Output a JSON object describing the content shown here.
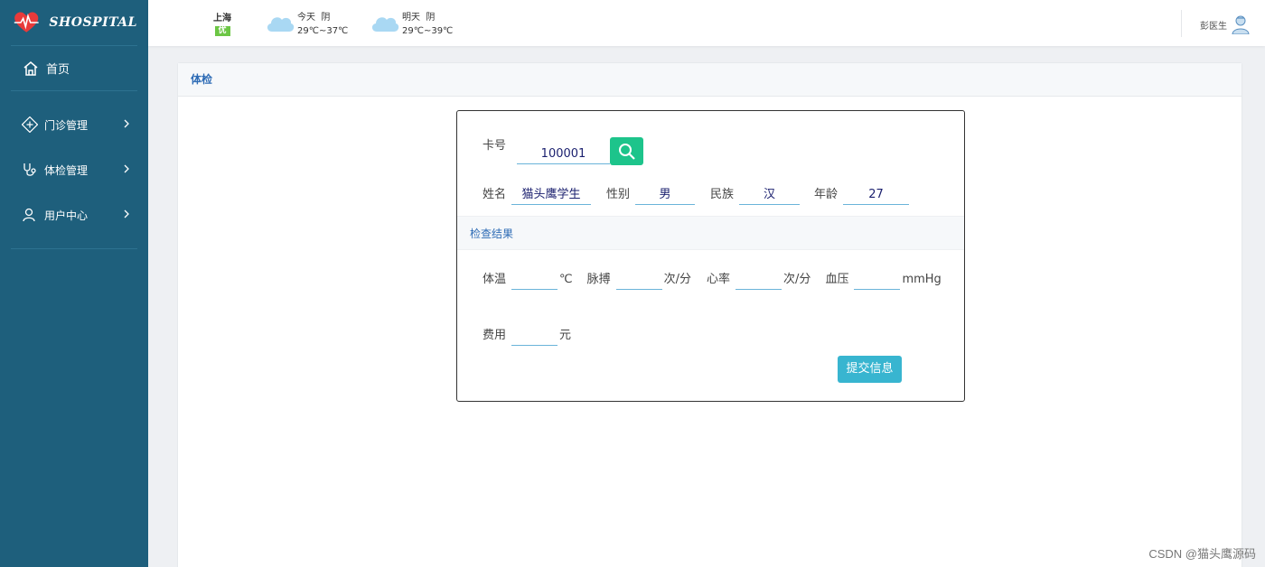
{
  "app": {
    "logo_text": "SHOSPITAL"
  },
  "sidebar": {
    "home_label": "首页",
    "items": [
      {
        "label": "门诊管理"
      },
      {
        "label": "体检管理"
      },
      {
        "label": "用户中心"
      }
    ]
  },
  "topbar": {
    "city": "上海",
    "aqi": "优",
    "today": {
      "label": "今天",
      "condition": "阴",
      "temp": "29℃~37℃"
    },
    "tomorrow": {
      "label": "明天",
      "condition": "阴",
      "temp": "29℃~39℃"
    },
    "user_name": "彭医生"
  },
  "panel": {
    "title": "体检"
  },
  "form": {
    "card_label": "卡号",
    "card_value": "100001",
    "name_label": "姓名",
    "name_value": "猫头鹰学生",
    "gender_label": "性别",
    "gender_value": "男",
    "ethnicity_label": "民族",
    "ethnicity_value": "汉",
    "age_label": "年龄",
    "age_value": "27",
    "section_title": "检查结果",
    "temp_label": "体温",
    "temp_value": "",
    "temp_unit": "℃",
    "pulse_label": "脉搏",
    "pulse_value": "",
    "pulse_unit": "次/分",
    "heart_label": "心率",
    "heart_value": "",
    "heart_unit": "次/分",
    "bp_label": "血压",
    "bp_value": "",
    "bp_unit": "mmHg",
    "fee_label": "费用",
    "fee_value": "",
    "fee_unit": "元",
    "submit_label": "提交信息"
  },
  "watermark": "CSDN @猫头鹰源码",
  "colors": {
    "sidebar": "#1e5f7c",
    "accent": "#1dc48b",
    "submit": "#38b5d0",
    "link": "#2d6bb5"
  }
}
